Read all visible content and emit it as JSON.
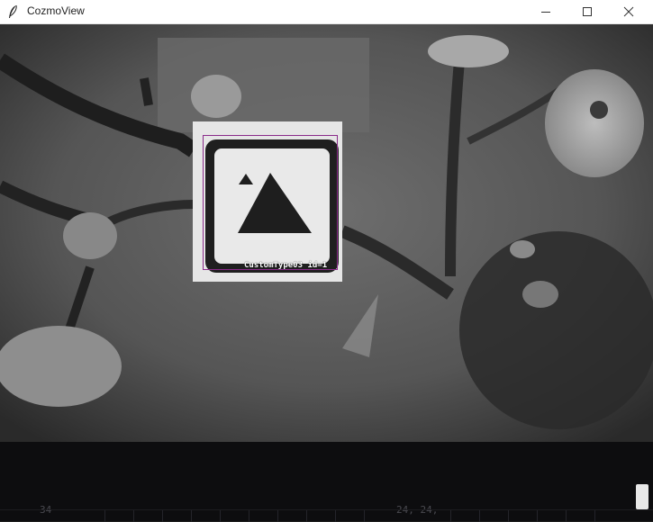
{
  "window": {
    "title": "CozmoView",
    "app_icon": "feather-icon",
    "controls": {
      "minimize_icon": "minimize-icon",
      "maximize_icon": "maximize-icon",
      "close_icon": "close-icon"
    }
  },
  "camera_view": {
    "detected_object": {
      "label": "CustomType03 id=1",
      "box_color": "#8a2a8a"
    }
  },
  "bottom_panel": {
    "left_text": "34",
    "mid_text": "24, 24,"
  }
}
